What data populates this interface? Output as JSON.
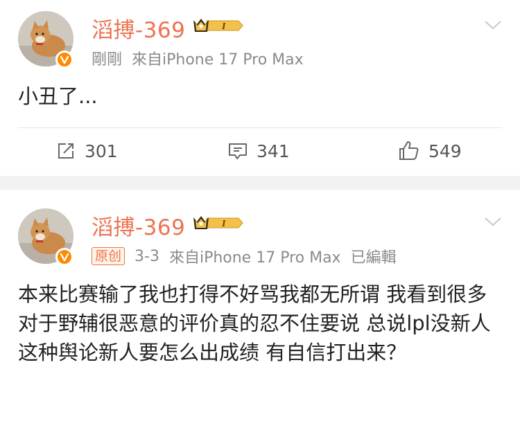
{
  "colors": {
    "name": "#eb7350",
    "meta": "#8a8a8a",
    "badge": "#ff8a00"
  },
  "posts": [
    {
      "author": "滔搏-369",
      "time": "剛剛",
      "source": "來自iPhone 17 Pro Max",
      "content": "小丑了...",
      "actions": {
        "repost": "301",
        "comment": "341",
        "like": "549"
      }
    },
    {
      "author": "滔搏-369",
      "tag": "原创",
      "time": "3-3",
      "source": "來自iPhone 17 Pro Max",
      "edited": "已編輯",
      "content": "本来比赛输了我也打得不好骂我都无所谓  我看到很多对于野辅很恶意的评价真的忍不住要说 总说lpl没新人 这种舆论新人要怎么出成绩 有自信打出来？"
    }
  ],
  "icons": {
    "vip": "crown-vip-badge-icon",
    "verified": "verified-v-icon",
    "more": "chevron-down-icon",
    "repost": "repost-icon",
    "comment": "comment-icon",
    "like": "thumbs-up-icon"
  }
}
